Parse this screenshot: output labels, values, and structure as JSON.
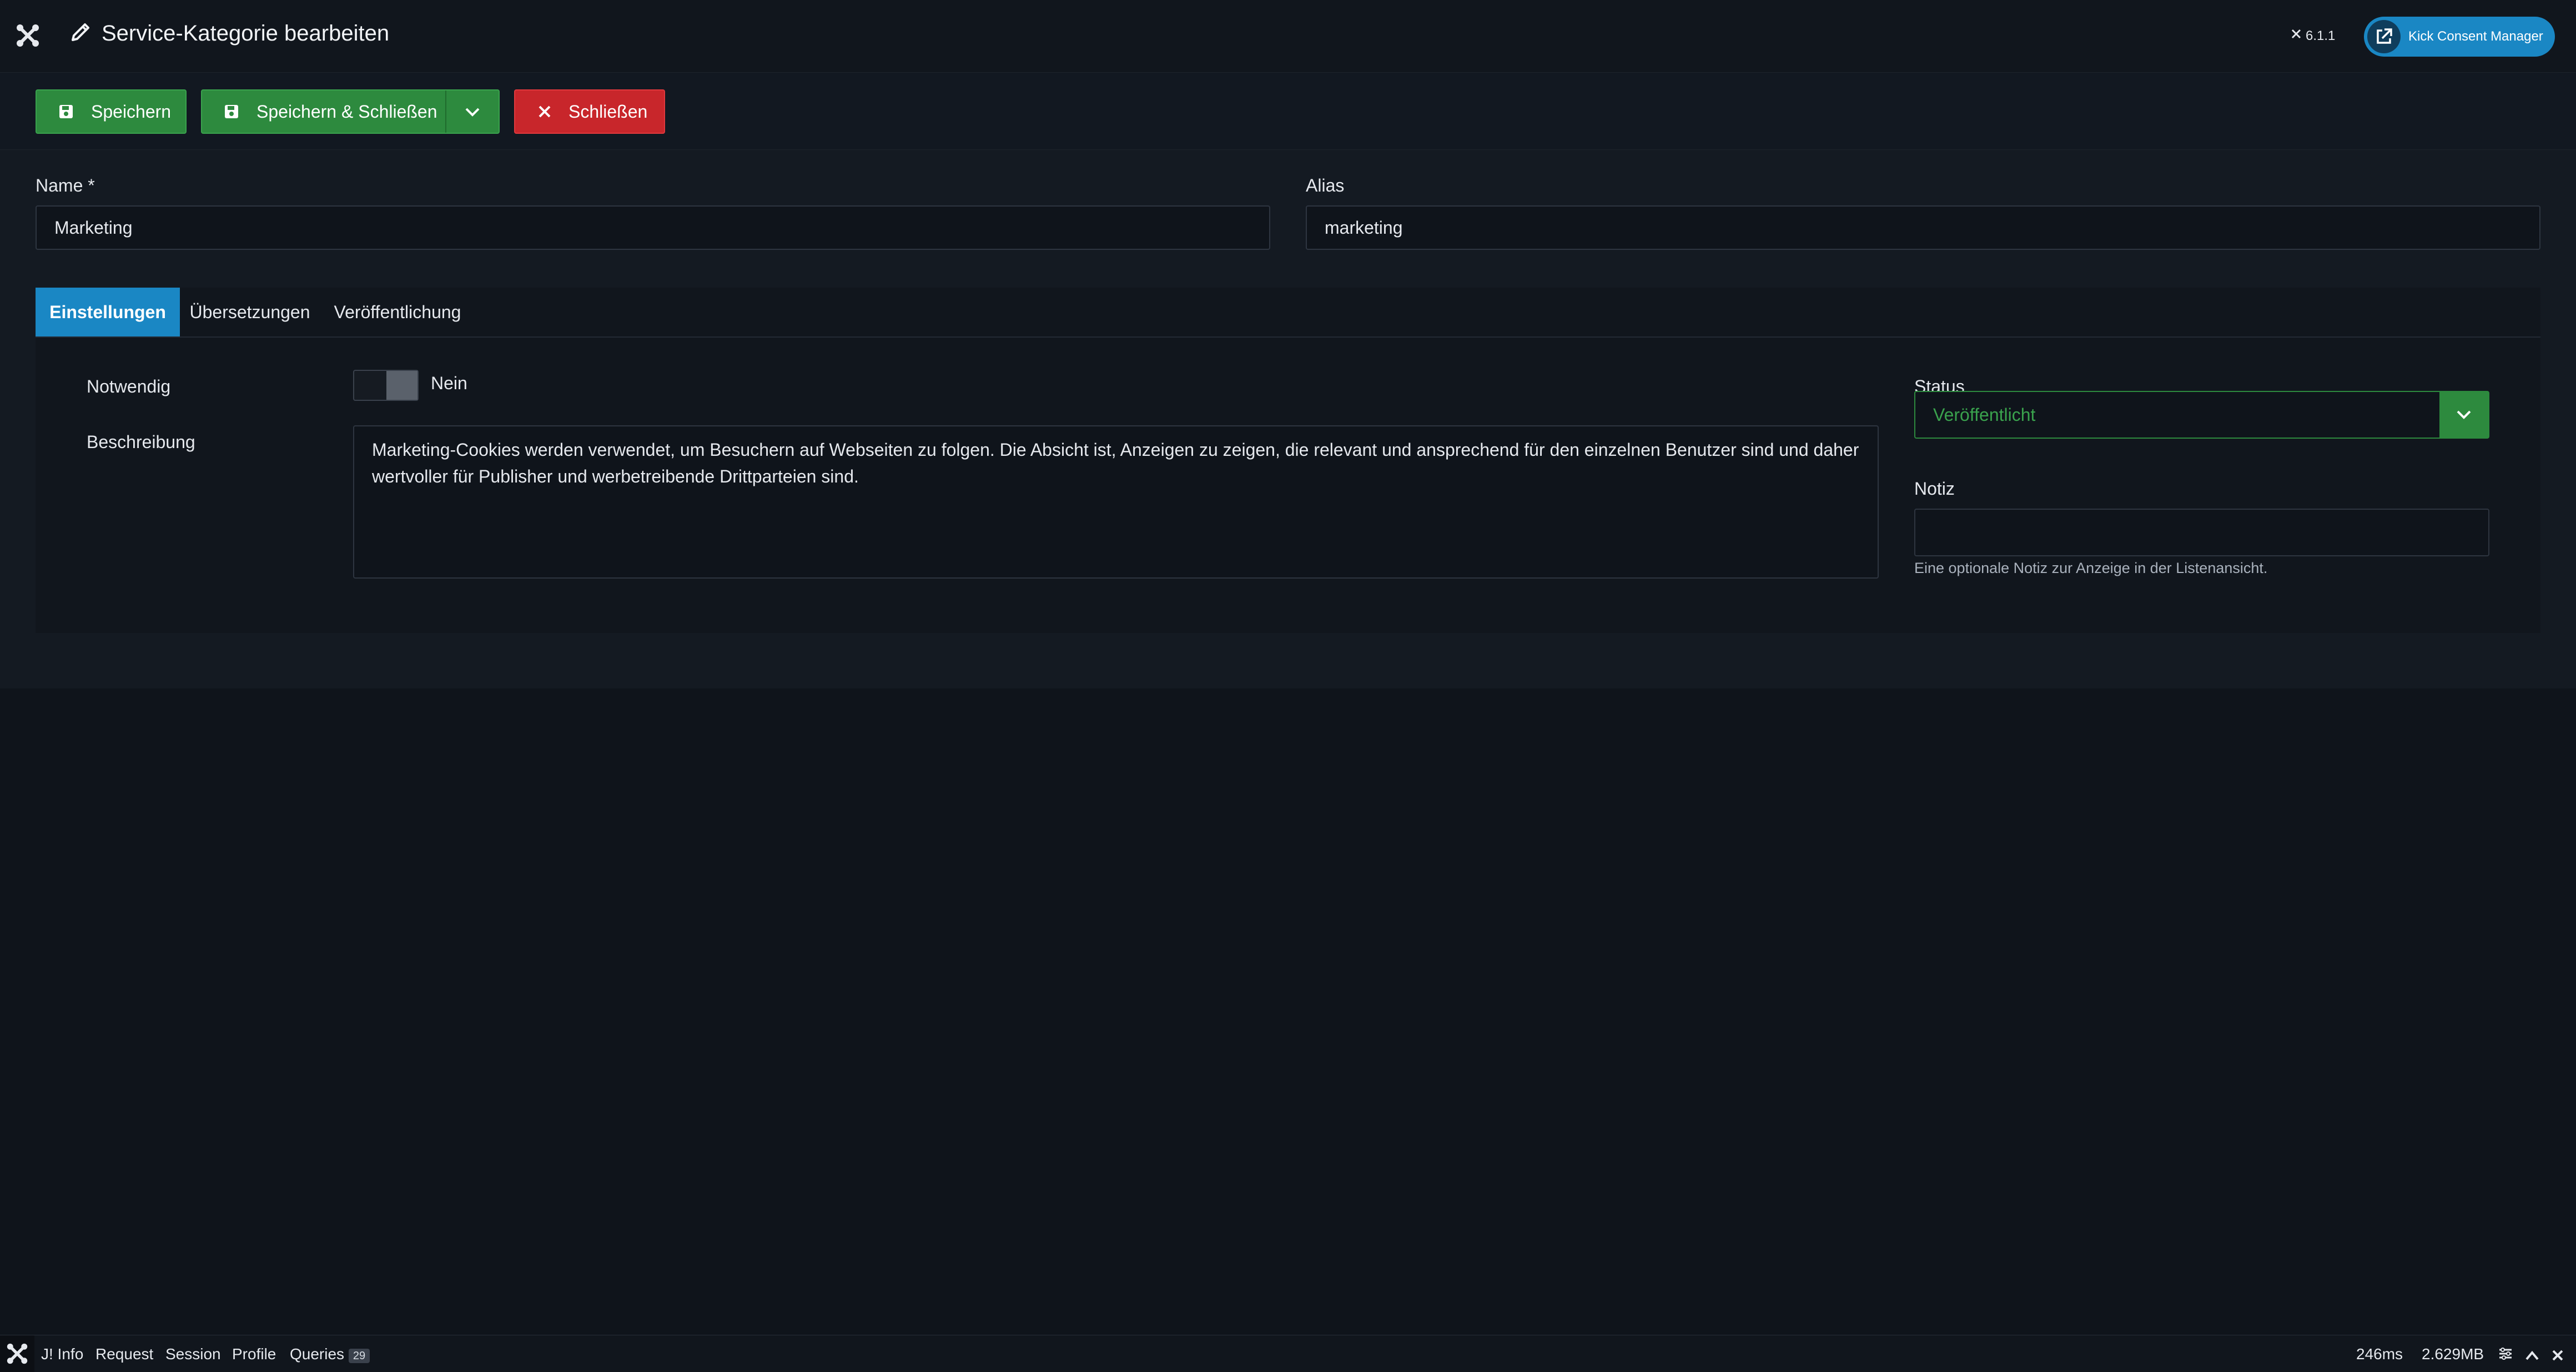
{
  "header": {
    "title": "Service-Kategorie bearbeiten",
    "version": "6.1.1",
    "external_button_label": "Kick Consent Manager"
  },
  "toolbar": {
    "save_label": "Speichern",
    "save_close_label": "Speichern & Schließen",
    "close_label": "Schließen"
  },
  "form": {
    "name_label": "Name *",
    "name_value": "Marketing",
    "alias_label": "Alias",
    "alias_value": "marketing"
  },
  "tabs": [
    {
      "label": "Einstellungen",
      "active": true
    },
    {
      "label": "Übersetzungen",
      "active": false
    },
    {
      "label": "Veröffentlichung",
      "active": false
    }
  ],
  "settings": {
    "required_label": "Notwendig",
    "required_value": "Nein",
    "description_label": "Beschreibung",
    "description_value": "Marketing-Cookies werden verwendet, um Besuchern auf Webseiten zu folgen. Die Absicht ist, Anzeigen zu zeigen, die relevant und ansprechend für den einzelnen Benutzer sind und daher wertvoller für Publisher und werbetreibende Drittparteien sind.",
    "status_label": "Status",
    "status_value": "Veröffentlicht",
    "note_label": "Notiz",
    "note_value": "",
    "note_hint": "Eine optionale Notiz zur Anzeige in der Listenansicht."
  },
  "debugbar": {
    "items": [
      "J! Info",
      "Request",
      "Session",
      "Profile",
      "Queries"
    ],
    "queries_count": "29",
    "time": "246ms",
    "memory": "2.629MB"
  },
  "colors": {
    "accent_blue": "#1a87c4",
    "save_green": "#2d8a3e",
    "close_red": "#c8262b",
    "background": "#0f141b"
  },
  "icons": [
    "joomla-logo-icon",
    "pencil-icon",
    "joomla-small-icon",
    "external-link-icon",
    "save-icon",
    "chevron-down-icon",
    "close-x-icon",
    "settings-icon",
    "chevron-up-icon"
  ]
}
